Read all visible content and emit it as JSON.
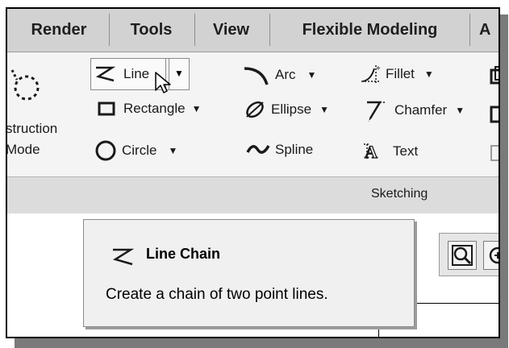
{
  "tabs": [
    "Render",
    "Tools",
    "View",
    "Flexible Modeling",
    "A"
  ],
  "construction": {
    "line1": "struction",
    "line2": "Mode"
  },
  "sketch_tools": {
    "line": "Line",
    "rectangle": "Rectangle",
    "circle": "Circle",
    "arc": "Arc",
    "ellipse": "Ellipse",
    "spline": "Spline",
    "fillet": "Fillet",
    "chamfer": "Chamfer",
    "text": "Text"
  },
  "group_label": "Sketching",
  "tooltip": {
    "title": "Line Chain",
    "description": "Create a chain of two point lines."
  },
  "icons": [
    "construction-mode-icon",
    "line-chain-icon",
    "rectangle-icon",
    "circle-icon",
    "arc-icon",
    "ellipse-icon",
    "spline-icon",
    "fillet-icon",
    "chamfer-icon",
    "text-icon",
    "zoom-icon",
    "cursor-icon"
  ],
  "colors": {
    "tab_bar": "#d2d2d2",
    "ribbon": "#f4f4f4",
    "tooltip": "#f0f0f0",
    "shadow": "#7a7a7a"
  }
}
